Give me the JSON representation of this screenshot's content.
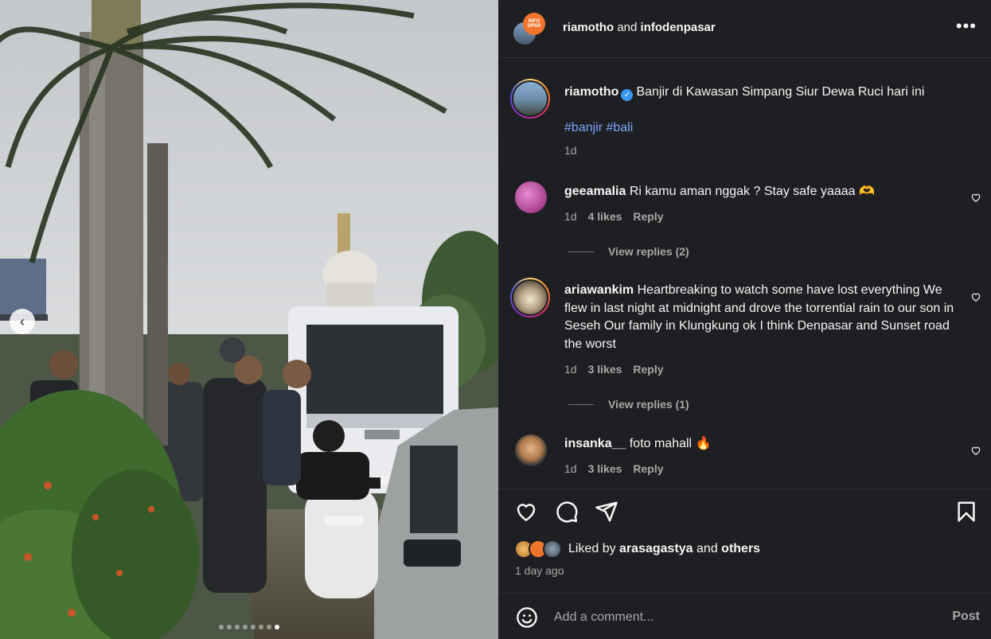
{
  "photo": {
    "alt_icons": {
      "prev": "chevron-left-icon"
    },
    "carousel_slides": 8,
    "active_slide": 7
  },
  "header": {
    "user1": "riamotho",
    "joiner": "and",
    "user2": "infodenpasar",
    "more_icon": "more-horizontal-icon",
    "user2_avatar_text": "INFO DPSR"
  },
  "caption": {
    "username": "riamotho",
    "verified_icon": "verified-badge-icon",
    "text": "Banjir di Kawasan Simpang Siur Dewa Ruci hari ini",
    "hashtags": "#banjir #bali",
    "time": "1d"
  },
  "comments": [
    {
      "username": "geeamalia",
      "text": "Ri kamu aman nggak ? Stay safe yaaaa 🫶",
      "time": "1d",
      "likes": "4 likes",
      "reply": "Reply",
      "view_replies": "View replies (2)"
    },
    {
      "username": "ariawankim",
      "text": "Heartbreaking to watch some have lost everything We flew in last night at midnight and drove the torrential rain to our son in Seseh Our family in Klungkung ok I think Denpasar and Sunset road the worst",
      "time": "1d",
      "likes": "3 likes",
      "reply": "Reply",
      "view_replies": "View replies (1)"
    },
    {
      "username": "insanka__",
      "text": "foto mahall 🔥",
      "time": "1d",
      "likes": "3 likes",
      "reply": "Reply"
    }
  ],
  "actions": {
    "like_icon": "heart-icon",
    "comment_icon": "comment-icon",
    "share_icon": "send-icon",
    "save_icon": "bookmark-icon"
  },
  "likes": {
    "prefix": "Liked by",
    "user": "arasagastya",
    "joiner": "and",
    "others": "others"
  },
  "posted_ago": "1 day ago",
  "add_comment": {
    "emoji_icon": "emoji-icon",
    "placeholder": "Add a comment...",
    "post_label": "Post"
  },
  "colors": {
    "panel_bg": "#1e1f22",
    "hashtag": "#7ea6ff",
    "verified": "#3897f0",
    "muted": "#a8a8a8"
  }
}
